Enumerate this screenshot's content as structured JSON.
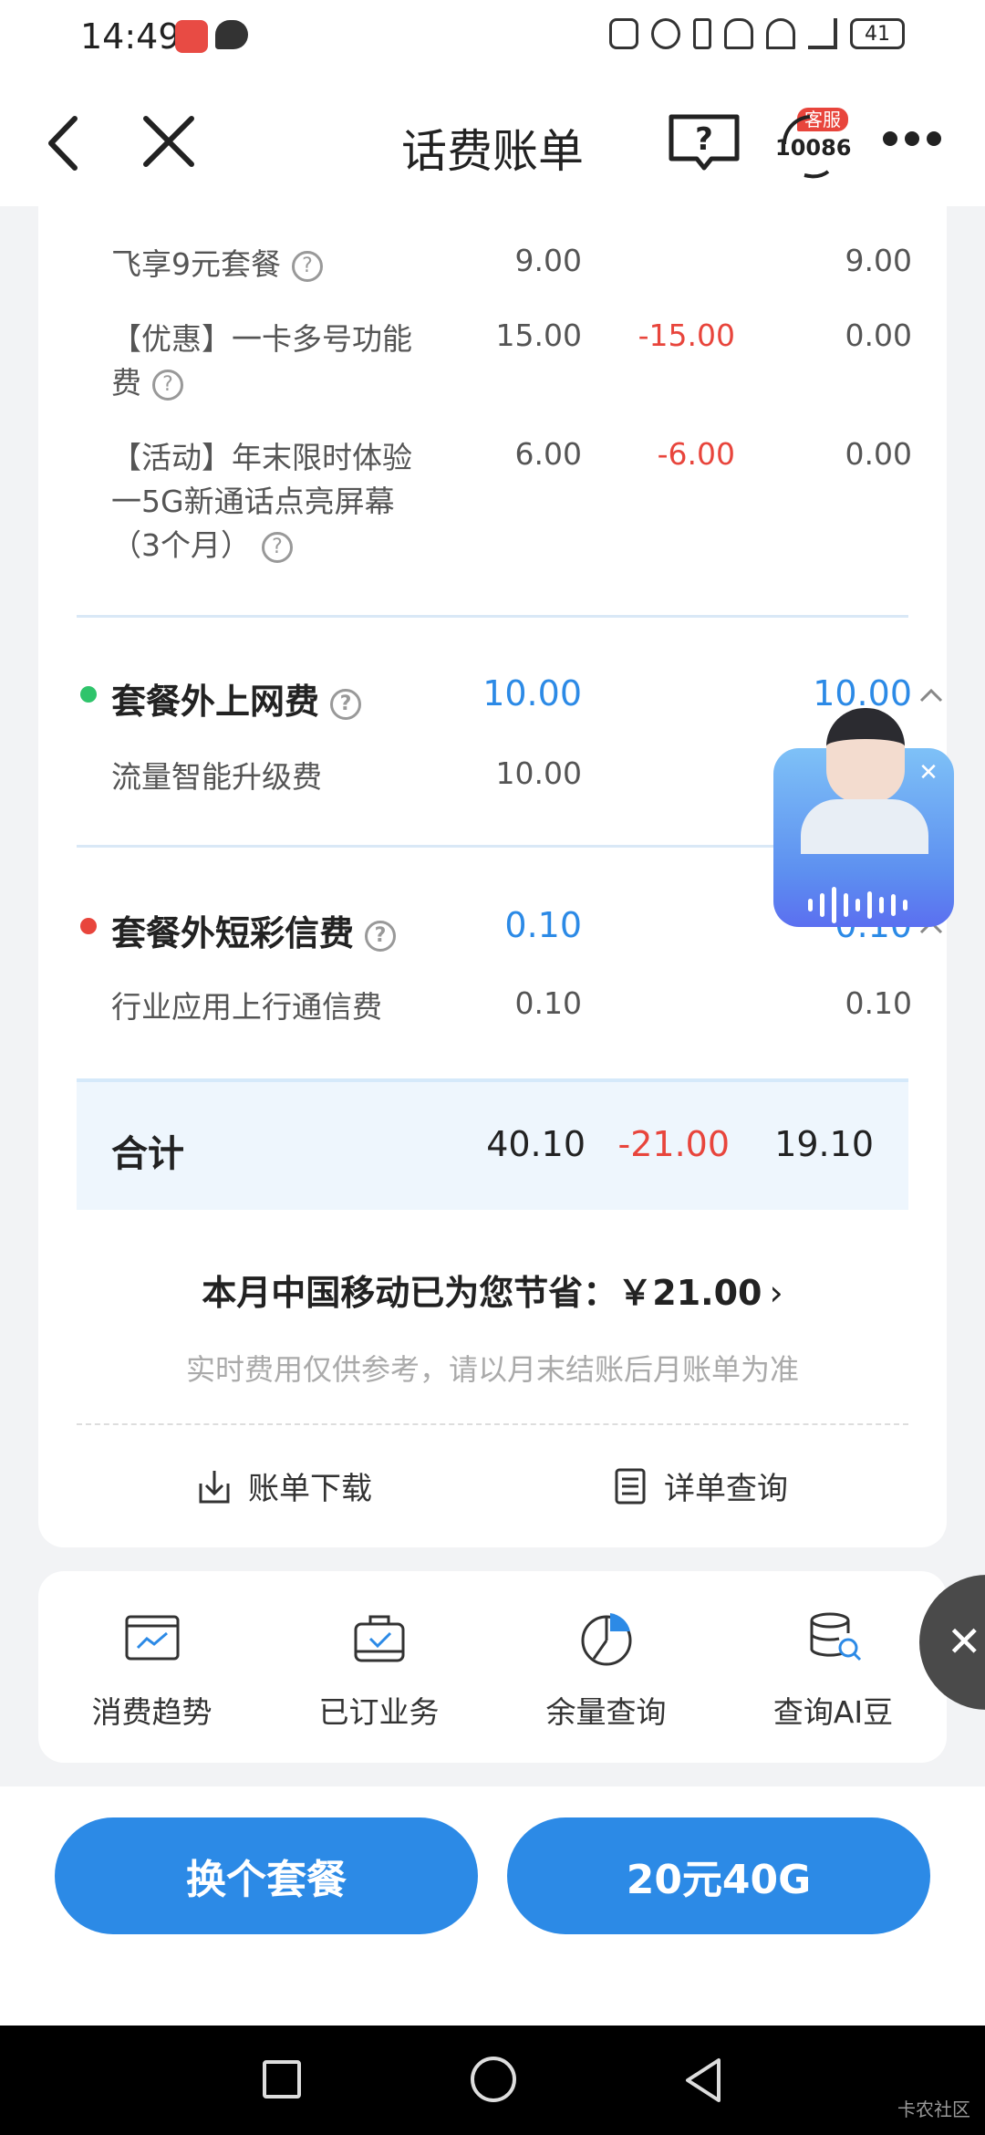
{
  "status_bar": {
    "time": "14:49",
    "battery": "41"
  },
  "header": {
    "title": "话费账单",
    "service_badge": "客服",
    "service_number": "10086"
  },
  "bill_items": [
    {
      "name": "飞享9元套餐",
      "amount": "9.00",
      "discount": "",
      "actual": "9.00"
    },
    {
      "name": "【优惠】一卡多号功能费",
      "amount": "15.00",
      "discount": "-15.00",
      "actual": "0.00"
    },
    {
      "name": "【活动】年末限时体验一5G新通话点亮屏幕（3个月）",
      "amount": "6.00",
      "discount": "-6.00",
      "actual": "0.00"
    }
  ],
  "sections": [
    {
      "title": "套餐外上网费",
      "amount": "10.00",
      "actual": "10.00",
      "dot_color": "#2fc46b",
      "items": [
        {
          "name": "流量智能升级费",
          "amount": "10.00",
          "actual": ""
        }
      ]
    },
    {
      "title": "套餐外短彩信费",
      "amount": "0.10",
      "actual": "0.10",
      "dot_color": "#e8453c",
      "items": [
        {
          "name": "行业应用上行通信费",
          "amount": "0.10",
          "actual": "0.10"
        }
      ]
    }
  ],
  "total": {
    "label": "合计",
    "amount": "40.10",
    "discount": "-21.00",
    "actual": "19.10"
  },
  "saving_text": "本月中国移动已为您节省：￥21.00",
  "notice": "实时费用仅供参考，请以月末结账后月账单为准",
  "actions": {
    "download": "账单下载",
    "detail": "详单查询"
  },
  "shortcuts": [
    "消费趋势",
    "已订业务",
    "余量查询",
    "查询AI豆"
  ],
  "buttons": {
    "change_plan": "换个套餐",
    "promo": "20元40G"
  },
  "watermark": "卡农社区",
  "colors": {
    "accent": "#2c8ae6",
    "negative": "#e8453c"
  }
}
